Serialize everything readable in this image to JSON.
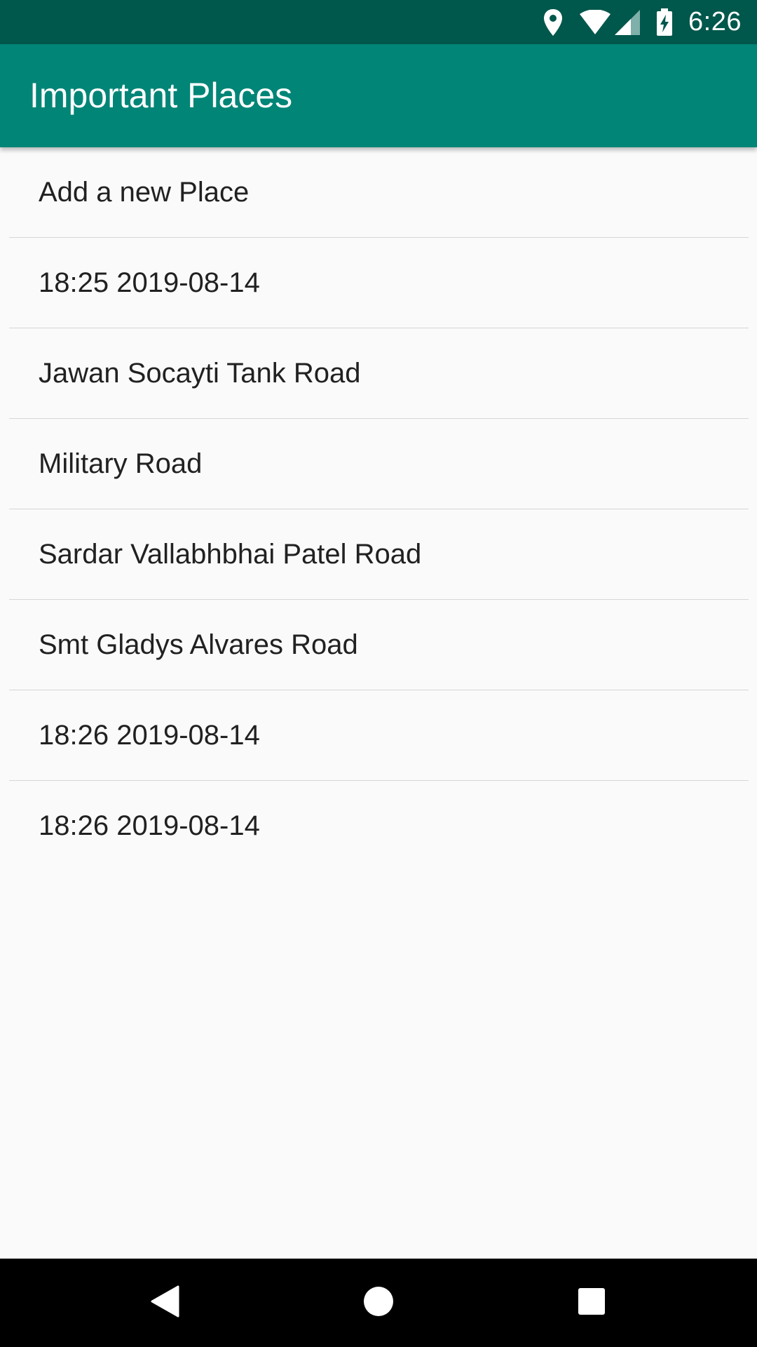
{
  "status_bar": {
    "time": "6:26",
    "icons": [
      "location-icon",
      "wifi-icon",
      "cell-signal-icon",
      "battery-charging-icon"
    ],
    "background": "#00574b"
  },
  "app_bar": {
    "title": "Important Places",
    "background": "#008577"
  },
  "list": {
    "items": [
      {
        "label": "Add a new Place"
      },
      {
        "label": "18:25 2019-08-14"
      },
      {
        "label": "Jawan Socayti Tank Road"
      },
      {
        "label": "Military Road"
      },
      {
        "label": "Sardar Vallabhbhai Patel Road"
      },
      {
        "label": "Smt Gladys Alvares Road"
      },
      {
        "label": "18:26 2019-08-14"
      },
      {
        "label": "18:26 2019-08-14"
      }
    ]
  },
  "nav_bar": {
    "buttons": [
      "back-icon",
      "home-icon",
      "recents-icon"
    ],
    "background": "#000000"
  }
}
